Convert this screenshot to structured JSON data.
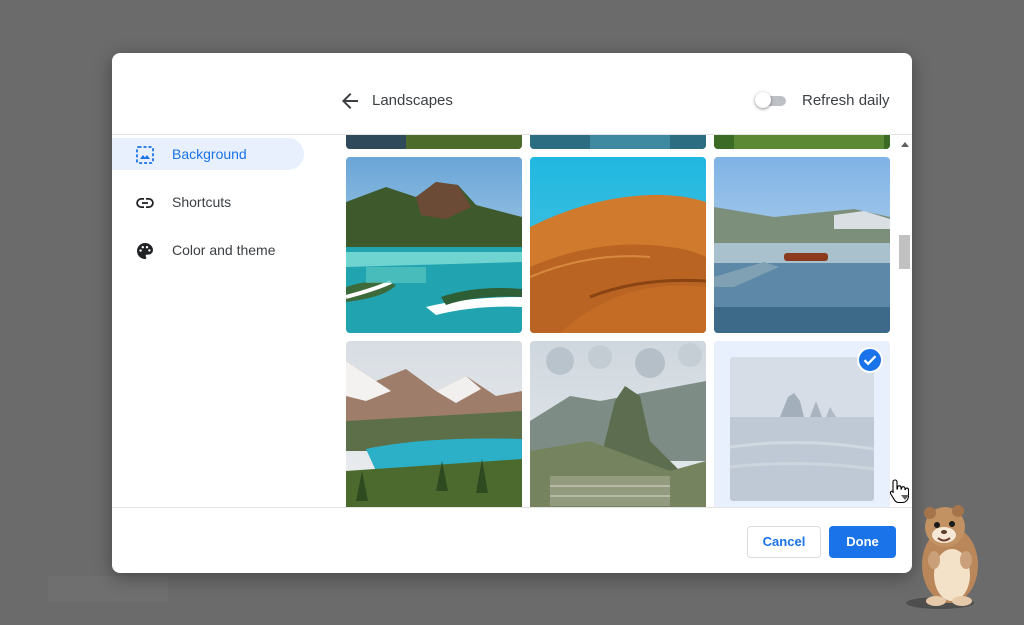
{
  "header": {
    "back_icon": "arrow-left-icon",
    "title": "Landscapes",
    "refresh_label": "Refresh daily",
    "refresh_on": false
  },
  "sidebar": {
    "items": [
      {
        "label": "Background",
        "icon": "background-image-icon",
        "active": true
      },
      {
        "label": "Shortcuts",
        "icon": "link-icon",
        "active": false
      },
      {
        "label": "Color and theme",
        "icon": "palette-icon",
        "active": false
      }
    ]
  },
  "gallery": {
    "tiles": [
      {
        "subject": "island-coast",
        "selected": false
      },
      {
        "subject": "desert-dunes",
        "selected": false
      },
      {
        "subject": "lake-pier",
        "selected": false
      },
      {
        "subject": "mountain-lake",
        "selected": false
      },
      {
        "subject": "mountain-ruins",
        "selected": false
      },
      {
        "subject": "misty-sea-stacks",
        "selected": true
      }
    ],
    "selected_icon": "check-circle-icon"
  },
  "footer": {
    "cancel_label": "Cancel",
    "done_label": "Done"
  },
  "colors": {
    "accent": "#1a73e8",
    "active_nav_bg": "#e8f0fe",
    "backdrop": "#6b6b6b",
    "text": "#3c4043"
  }
}
